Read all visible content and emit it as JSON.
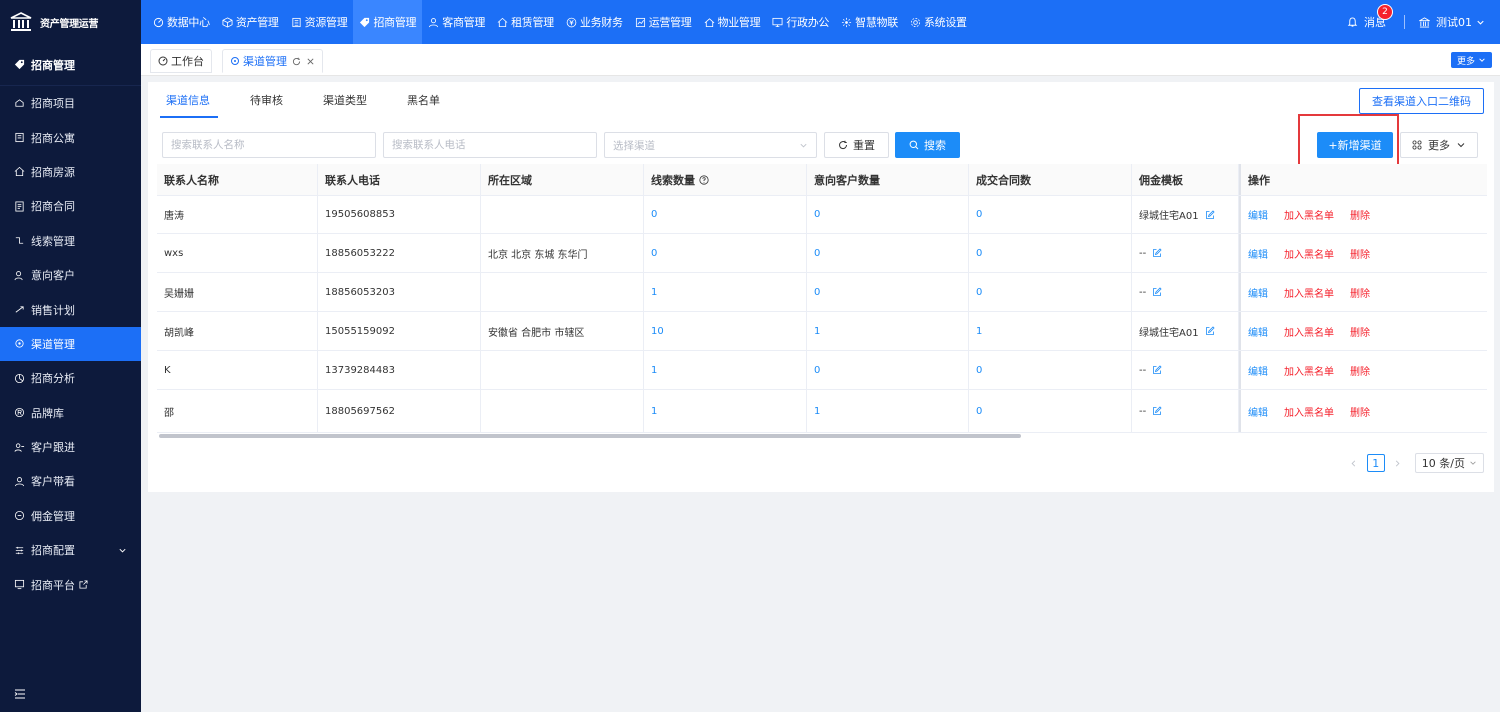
{
  "app": {
    "logo_text": "资产管理运营"
  },
  "nav": {
    "items": [
      {
        "label": "数据中心",
        "icon": "dashboard-icon"
      },
      {
        "label": "资产管理",
        "icon": "cube-icon"
      },
      {
        "label": "资源管理",
        "icon": "building-icon"
      },
      {
        "label": "招商管理",
        "icon": "tag-icon"
      },
      {
        "label": "客商管理",
        "icon": "users-icon"
      },
      {
        "label": "租赁管理",
        "icon": "house-icon"
      },
      {
        "label": "业务财务",
        "icon": "money-icon"
      },
      {
        "label": "运营管理",
        "icon": "chart-icon"
      },
      {
        "label": "物业管理",
        "icon": "home-icon"
      },
      {
        "label": "行政办公",
        "icon": "monitor-icon"
      },
      {
        "label": "智慧物联",
        "icon": "iot-icon"
      },
      {
        "label": "系统设置",
        "icon": "gear-icon"
      }
    ],
    "active_index": 3,
    "messages_label": "消息",
    "messages_count": "2",
    "user_label": "测试01"
  },
  "sidebar": {
    "header": "招商管理",
    "items": [
      {
        "label": "招商项目"
      },
      {
        "label": "招商公寓"
      },
      {
        "label": "招商房源"
      },
      {
        "label": "招商合同"
      },
      {
        "label": "线索管理"
      },
      {
        "label": "意向客户"
      },
      {
        "label": "销售计划"
      },
      {
        "label": "渠道管理"
      },
      {
        "label": "招商分析"
      },
      {
        "label": "品牌库"
      },
      {
        "label": "客户跟进"
      },
      {
        "label": "客户带看"
      },
      {
        "label": "佣金管理"
      },
      {
        "label": "招商配置"
      },
      {
        "label": "招商平台"
      }
    ],
    "active_index": 7
  },
  "tabs": {
    "items": [
      {
        "label": "工作台"
      },
      {
        "label": "渠道管理"
      }
    ],
    "more_label": "更多"
  },
  "page": {
    "subtabs": [
      {
        "label": "渠道信息"
      },
      {
        "label": "待审核"
      },
      {
        "label": "渠道类型"
      },
      {
        "label": "黑名单"
      }
    ],
    "qr_button": "查看渠道入口二维码",
    "filters": {
      "name_placeholder": "搜索联系人名称",
      "phone_placeholder": "搜索联系人电话",
      "channel_placeholder": "选择渠道",
      "reset_label": "重置",
      "search_label": "搜索"
    },
    "add_button": "+新增渠道",
    "more_button": "更多"
  },
  "table": {
    "columns": [
      "联系人名称",
      "联系人电话",
      "所在区域",
      "线索数量",
      "意向客户数量",
      "成交合同数",
      "佣金模板",
      "操作"
    ],
    "rows": [
      {
        "name": "唐涛",
        "phone": "19505608853",
        "region": "",
        "leads": "0",
        "intents": "0",
        "deals": "0",
        "template": "绿城住宅A01"
      },
      {
        "name": "wxs",
        "phone": "18856053222",
        "region": "北京 北京 东城 东华门",
        "leads": "0",
        "intents": "0",
        "deals": "0",
        "template": "--"
      },
      {
        "name": "吴姗姗",
        "phone": "18856053203",
        "region": "",
        "leads": "1",
        "intents": "0",
        "deals": "0",
        "template": "--"
      },
      {
        "name": "胡凯峰",
        "phone": "15055159092",
        "region": "安徽省 合肥市 市辖区",
        "leads": "10",
        "intents": "1",
        "deals": "1",
        "template": "绿城住宅A01"
      },
      {
        "name": "K",
        "phone": "13739284483",
        "region": "",
        "leads": "1",
        "intents": "0",
        "deals": "0",
        "template": "--"
      },
      {
        "name": "邵",
        "phone": "18805697562",
        "region": "",
        "leads": "1",
        "intents": "1",
        "deals": "0",
        "template": "--"
      }
    ],
    "actions": {
      "edit": "编辑",
      "blacklist": "加入黑名单",
      "delete": "删除"
    }
  },
  "pagination": {
    "current": "1",
    "page_size": "10 条/页"
  },
  "colors": {
    "primary": "#1c6ff6",
    "sidebar": "#0d1a3c",
    "danger": "#f5222d",
    "highlight": "#e4393c"
  }
}
